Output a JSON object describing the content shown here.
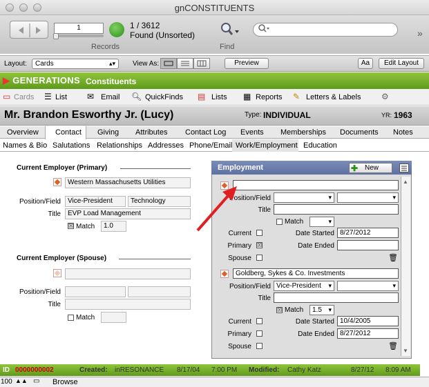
{
  "window": {
    "title": "gnCONSTITUENTS"
  },
  "toolbar": {
    "record_input": "1",
    "record_count": "1 / 3612",
    "found": "Found (Unsorted)",
    "records_label": "Records",
    "find_label": "Find",
    "more": "»"
  },
  "layoutbar": {
    "layout_label": "Layout:",
    "layout_value": "Cards",
    "view_as_label": "View As:",
    "preview": "Preview",
    "font_btn": "Aa",
    "edit_layout": "Edit Layout"
  },
  "banner": {
    "logo": "GENERATIONS",
    "module": "Constituents"
  },
  "nav": {
    "cards": "Cards",
    "list": "List",
    "email": "Email",
    "quickfinds": "QuickFinds",
    "lists": "Lists",
    "reports": "Reports",
    "letters": "Letters & Labels"
  },
  "record": {
    "name": "Mr. Brandon Esworthy Jr. (Lucy)",
    "type_label": "Type:",
    "type": "INDIVIDUAL",
    "yr_label": "YR:",
    "yr": "1963"
  },
  "tabs": [
    "Overview",
    "Contact",
    "Giving",
    "Attributes",
    "Contact Log",
    "Events",
    "Memberships",
    "Documents",
    "Notes"
  ],
  "subtabs": [
    "Names & Bio",
    "Salutations",
    "Relationships",
    "Addresses",
    "Phone/Email",
    "Work/Employment",
    "Education"
  ],
  "primary": {
    "title": "Current Employer (Primary)",
    "employer": "Western Massachusetts Utilities",
    "pos_label": "Position/Field",
    "position": "Vice-President",
    "field": "Technology",
    "title_label": "Title",
    "title_value": "EVP Load Management",
    "match_label": "Match",
    "match_value": "1.0",
    "match_checked": "☒"
  },
  "spouse": {
    "title": "Current Employer (Spouse)",
    "pos_label": "Position/Field",
    "title_label": "Title",
    "match_label": "Match"
  },
  "employment": {
    "title": "Employment",
    "new_label": "New",
    "rec1": {
      "employer": "",
      "pos_label": "Position/Field",
      "title_label": "Title",
      "match_label": "Match",
      "current_label": "Current",
      "primary_label": "Primary",
      "spouse_label": "Spouse",
      "primary_checked": "☒",
      "date_started_label": "Date Started",
      "date_started": "8/27/2012",
      "date_ended_label": "Date Ended",
      "date_ended": ""
    },
    "rec2": {
      "employer": "Goldberg, Sykes & Co. Investments",
      "pos_label": "Position/Field",
      "position": "Vice-President",
      "title_label": "Title",
      "match_label": "Match",
      "match_value": "1.5",
      "match_checked": "☒",
      "current_label": "Current",
      "primary_label": "Primary",
      "spouse_label": "Spouse",
      "date_started_label": "Date Started",
      "date_started": "10/4/2005",
      "date_ended_label": "Date Ended",
      "date_ended": "8/27/2012"
    }
  },
  "status": {
    "id_label": "ID",
    "id": "0000000002",
    "created_label": "Created:",
    "created_by": "inRESONANCE",
    "created_date": "8/17/04",
    "created_time": "7:00 PM",
    "modified_label": "Modified:",
    "modified_by": "Cathy Katz",
    "modified_date": "8/27/12",
    "modified_time": "8:09 AM"
  },
  "bottom": {
    "zoom": "100",
    "mode": "Browse"
  }
}
